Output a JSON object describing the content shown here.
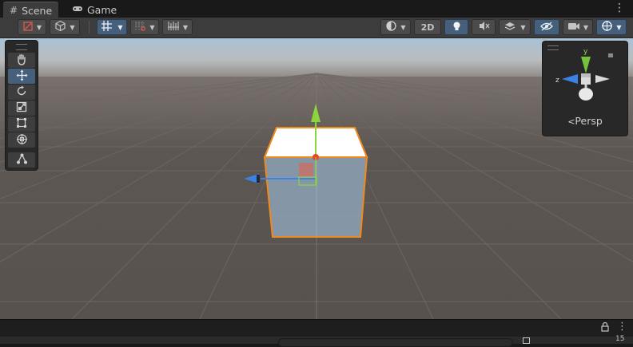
{
  "tabs": [
    {
      "label": "Scene",
      "icon": "grid-hash-icon",
      "active": true
    },
    {
      "label": "Game",
      "icon": "gamepad-icon",
      "active": false
    }
  ],
  "toolbar": {
    "toggle_2d_label": "2D",
    "icons": [
      "draw-mode-icon",
      "shading-cube-icon",
      "grid-toggle-icon",
      "snap-icon",
      "increment-snap-icon",
      "shading-sphere-icon",
      "light-bulb-icon",
      "audio-mute-icon",
      "effects-layers-icon",
      "visibility-icon",
      "camera-icon",
      "gizmos-icon"
    ]
  },
  "tools": [
    "hand-tool",
    "move-tool",
    "rotate-tool",
    "scale-tool",
    "rect-tool",
    "transform-tool",
    "custom-editor-tool"
  ],
  "gizmo": {
    "projection_label": "Persp",
    "axes": {
      "y": "y",
      "z": "z"
    }
  },
  "colors": {
    "axis_x": "#e5472a",
    "axis_y": "#8cd43c",
    "axis_z": "#3b82e6",
    "selection_outline": "#f08a1c",
    "active_button": "#46607c"
  },
  "footer": {
    "status_number": "15"
  }
}
